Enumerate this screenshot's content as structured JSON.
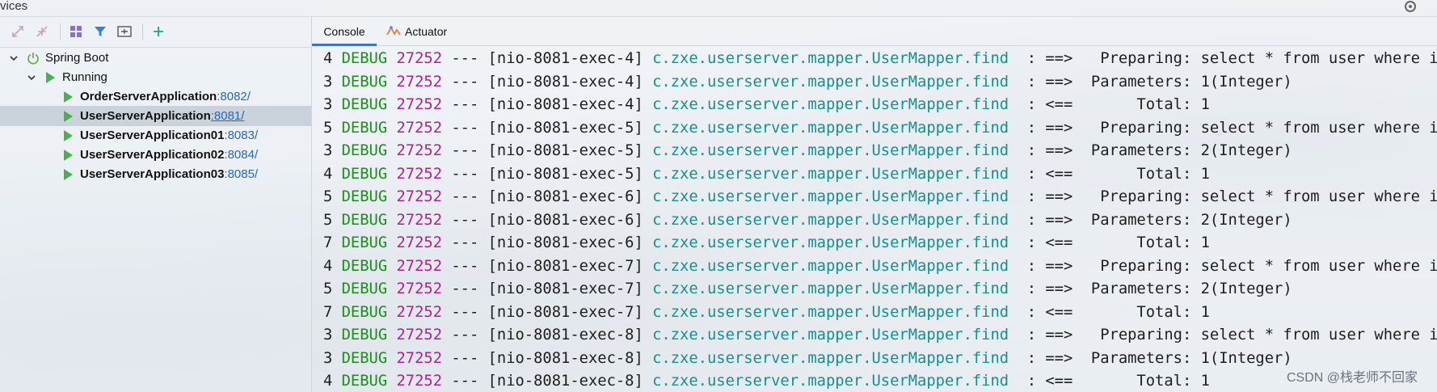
{
  "window": {
    "title": "vices"
  },
  "toolbar": {
    "items": [
      {
        "name": "expand-all-icon"
      },
      {
        "name": "collapse-all-icon"
      },
      {
        "name": "group-icon"
      },
      {
        "name": "filter-icon"
      },
      {
        "name": "new-tab-icon"
      },
      {
        "name": "add-icon"
      }
    ]
  },
  "tree": {
    "root_label": "Spring Boot",
    "group_label": "Running",
    "apps": [
      {
        "name": "OrderServerApplication",
        "port": ":8082/",
        "selected": false
      },
      {
        "name": "UserServerApplication",
        "port": ":8081/",
        "selected": true
      },
      {
        "name": "UserServerApplication01",
        "port": ":8083/",
        "selected": false
      },
      {
        "name": "UserServerApplication02",
        "port": ":8084/",
        "selected": false
      },
      {
        "name": "UserServerApplication03",
        "port": ":8085/",
        "selected": false
      }
    ]
  },
  "tabs": {
    "console": "Console",
    "actuator": "Actuator"
  },
  "console": {
    "lines": [
      {
        "p": "4",
        "level": "DEBUG",
        "pid": "27252",
        "sep": "---",
        "thread": "[nio-8081-exec-4]",
        "logger": "c.zxe.userserver.mapper.UserMapper.find",
        "arrow": ": ==>",
        "msg": "  Preparing: select * from user where id = ?"
      },
      {
        "p": "3",
        "level": "DEBUG",
        "pid": "27252",
        "sep": "---",
        "thread": "[nio-8081-exec-4]",
        "logger": "c.zxe.userserver.mapper.UserMapper.find",
        "arrow": ": ==>",
        "msg": " Parameters: 1(Integer)"
      },
      {
        "p": "3",
        "level": "DEBUG",
        "pid": "27252",
        "sep": "---",
        "thread": "[nio-8081-exec-4]",
        "logger": "c.zxe.userserver.mapper.UserMapper.find",
        "arrow": ": <==",
        "msg": "      Total: 1"
      },
      {
        "p": "5",
        "level": "DEBUG",
        "pid": "27252",
        "sep": "---",
        "thread": "[nio-8081-exec-5]",
        "logger": "c.zxe.userserver.mapper.UserMapper.find",
        "arrow": ": ==>",
        "msg": "  Preparing: select * from user where id = ?"
      },
      {
        "p": "3",
        "level": "DEBUG",
        "pid": "27252",
        "sep": "---",
        "thread": "[nio-8081-exec-5]",
        "logger": "c.zxe.userserver.mapper.UserMapper.find",
        "arrow": ": ==>",
        "msg": " Parameters: 2(Integer)"
      },
      {
        "p": "4",
        "level": "DEBUG",
        "pid": "27252",
        "sep": "---",
        "thread": "[nio-8081-exec-5]",
        "logger": "c.zxe.userserver.mapper.UserMapper.find",
        "arrow": ": <==",
        "msg": "      Total: 1"
      },
      {
        "p": "5",
        "level": "DEBUG",
        "pid": "27252",
        "sep": "---",
        "thread": "[nio-8081-exec-6]",
        "logger": "c.zxe.userserver.mapper.UserMapper.find",
        "arrow": ": ==>",
        "msg": "  Preparing: select * from user where id = ?"
      },
      {
        "p": "5",
        "level": "DEBUG",
        "pid": "27252",
        "sep": "---",
        "thread": "[nio-8081-exec-6]",
        "logger": "c.zxe.userserver.mapper.UserMapper.find",
        "arrow": ": ==>",
        "msg": " Parameters: 2(Integer)"
      },
      {
        "p": "7",
        "level": "DEBUG",
        "pid": "27252",
        "sep": "---",
        "thread": "[nio-8081-exec-6]",
        "logger": "c.zxe.userserver.mapper.UserMapper.find",
        "arrow": ": <==",
        "msg": "      Total: 1"
      },
      {
        "p": "4",
        "level": "DEBUG",
        "pid": "27252",
        "sep": "---",
        "thread": "[nio-8081-exec-7]",
        "logger": "c.zxe.userserver.mapper.UserMapper.find",
        "arrow": ": ==>",
        "msg": "  Preparing: select * from user where id = ?"
      },
      {
        "p": "5",
        "level": "DEBUG",
        "pid": "27252",
        "sep": "---",
        "thread": "[nio-8081-exec-7]",
        "logger": "c.zxe.userserver.mapper.UserMapper.find",
        "arrow": ": ==>",
        "msg": " Parameters: 2(Integer)"
      },
      {
        "p": "7",
        "level": "DEBUG",
        "pid": "27252",
        "sep": "---",
        "thread": "[nio-8081-exec-7]",
        "logger": "c.zxe.userserver.mapper.UserMapper.find",
        "arrow": ": <==",
        "msg": "      Total: 1"
      },
      {
        "p": "3",
        "level": "DEBUG",
        "pid": "27252",
        "sep": "---",
        "thread": "[nio-8081-exec-8]",
        "logger": "c.zxe.userserver.mapper.UserMapper.find",
        "arrow": ": ==>",
        "msg": "  Preparing: select * from user where id = ?"
      },
      {
        "p": "3",
        "level": "DEBUG",
        "pid": "27252",
        "sep": "---",
        "thread": "[nio-8081-exec-8]",
        "logger": "c.zxe.userserver.mapper.UserMapper.find",
        "arrow": ": ==>",
        "msg": " Parameters: 1(Integer)"
      },
      {
        "p": "4",
        "level": "DEBUG",
        "pid": "27252",
        "sep": "---",
        "thread": "[nio-8081-exec-8]",
        "logger": "c.zxe.userserver.mapper.UserMapper.find",
        "arrow": ": <==",
        "msg": "      Total: 1"
      }
    ]
  },
  "watermark": "CSDN @栈老师不回家",
  "colors": {
    "debug": "#1a8f1a",
    "pid": "#b0218f",
    "logger": "#14908e",
    "run": "#4caf50",
    "port": "#2a66b5",
    "tab_active": "#3b73c8"
  }
}
